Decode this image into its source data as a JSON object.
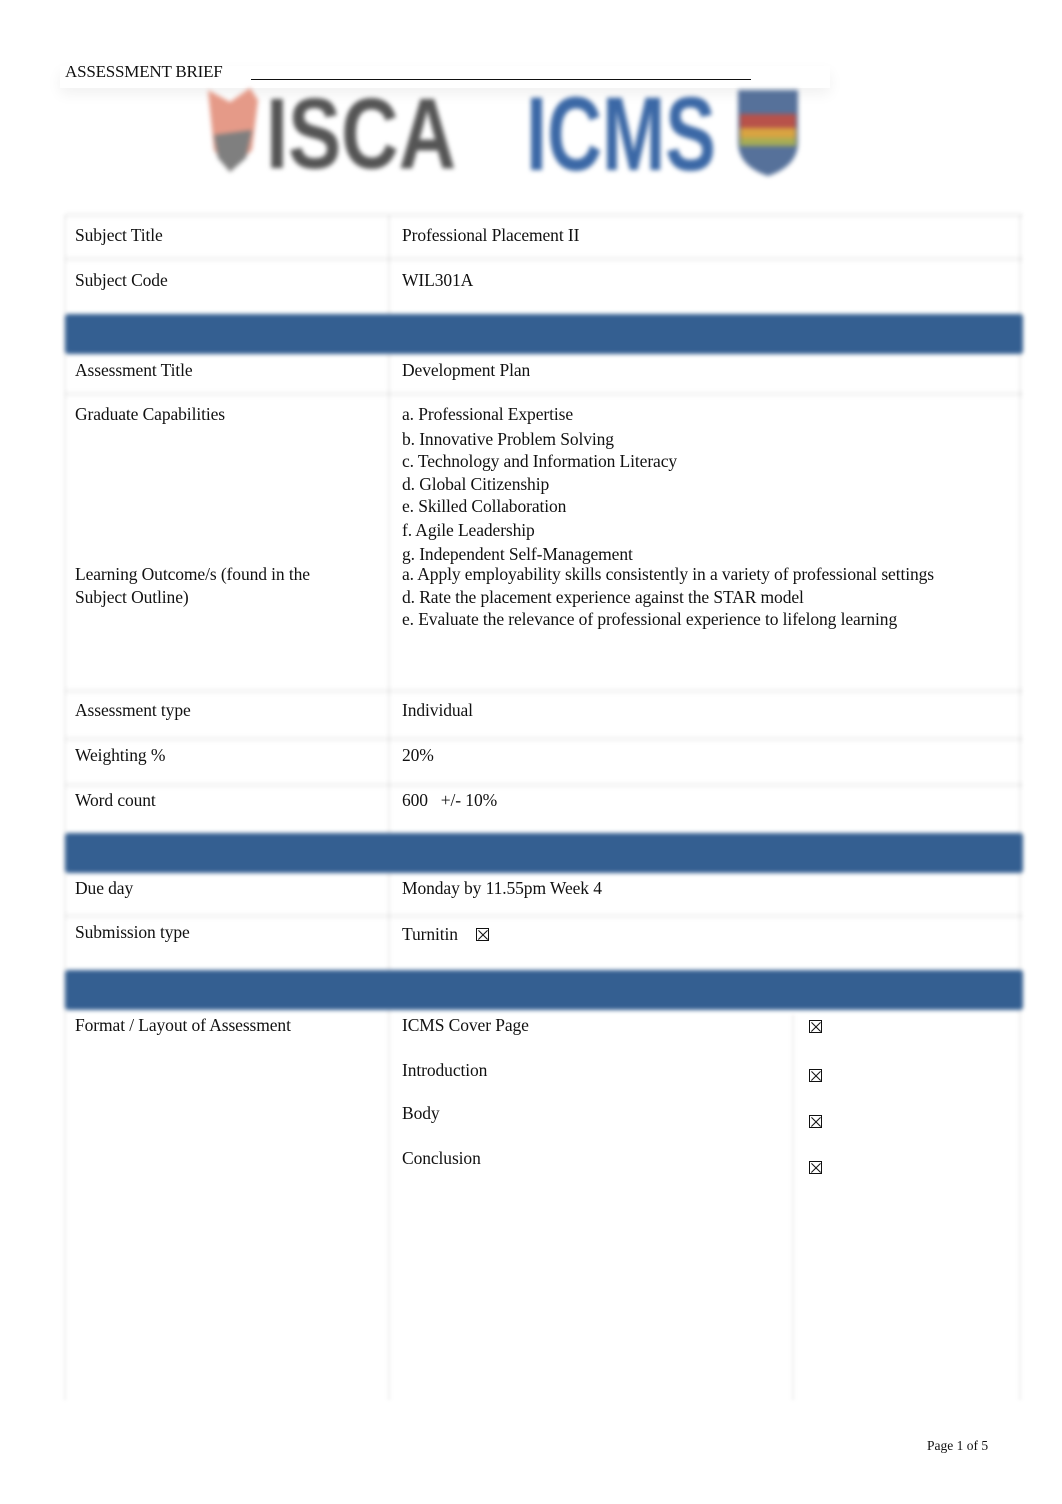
{
  "document": {
    "header_title": "ASSESSMENT BRIEF",
    "logos": {
      "left": {
        "name": "ISCA",
        "text": "ISCA",
        "text_color": "#555555",
        "accent_color": "#e58d7b"
      },
      "right": {
        "name": "ICMS",
        "text": "ICMS",
        "text_color": "#3b68a6",
        "crest_colors": [
          "#4b6a95",
          "#c0504d",
          "#d9a441",
          "#9fa84e"
        ]
      }
    },
    "band_color": "#345f91",
    "checkbox_icon": "checked-box-icon",
    "footer": "Page 1 of 5"
  },
  "section1": {
    "rows": [
      {
        "label": "Subject Title",
        "value": "Professional Placement II"
      },
      {
        "label": "Subject Code",
        "value": "WIL301A"
      }
    ]
  },
  "section2": {
    "assessment_title": {
      "label": "Assessment Title",
      "value": "Development Plan"
    },
    "graduate_capabilities": {
      "label": "Graduate Capabilities",
      "items": [
        "a. Professional Expertise",
        "b. Innovative Problem Solving",
        "c. Technology and Information Literacy",
        "d. Global Citizenship",
        "e. Skilled Collaboration",
        "f. Agile Leadership",
        "g. Independent Self-Management"
      ]
    },
    "learning_outcomes": {
      "label": "Learning Outcome/s (found in the Subject Outline)",
      "items": [
        "a. Apply employability skills consistently in a variety of professional settings",
        "d. Rate the placement experience against the STAR model",
        "e. Evaluate the relevance of professional experience to lifelong learning"
      ]
    },
    "assessment_type": {
      "label": "Assessment type",
      "value": "Individual"
    },
    "weighting": {
      "label": "Weighting %",
      "value": "20%"
    },
    "word_count": {
      "label": "Word count",
      "value": "600   +/- 10%"
    }
  },
  "section3": {
    "due_day": {
      "label": "Due day",
      "value": "Monday by 11.55pm Week 4"
    },
    "submission_type": {
      "label": "Submission type",
      "value": "Turnitin",
      "checked": true
    }
  },
  "section4": {
    "format": {
      "label": "Format / Layout of Assessment",
      "items": [
        {
          "label": "ICMS Cover Page",
          "checked": true
        },
        {
          "label": "Introduction",
          "checked": true
        },
        {
          "label": "Body",
          "checked": true
        },
        {
          "label": "Conclusion",
          "checked": true
        }
      ]
    }
  }
}
